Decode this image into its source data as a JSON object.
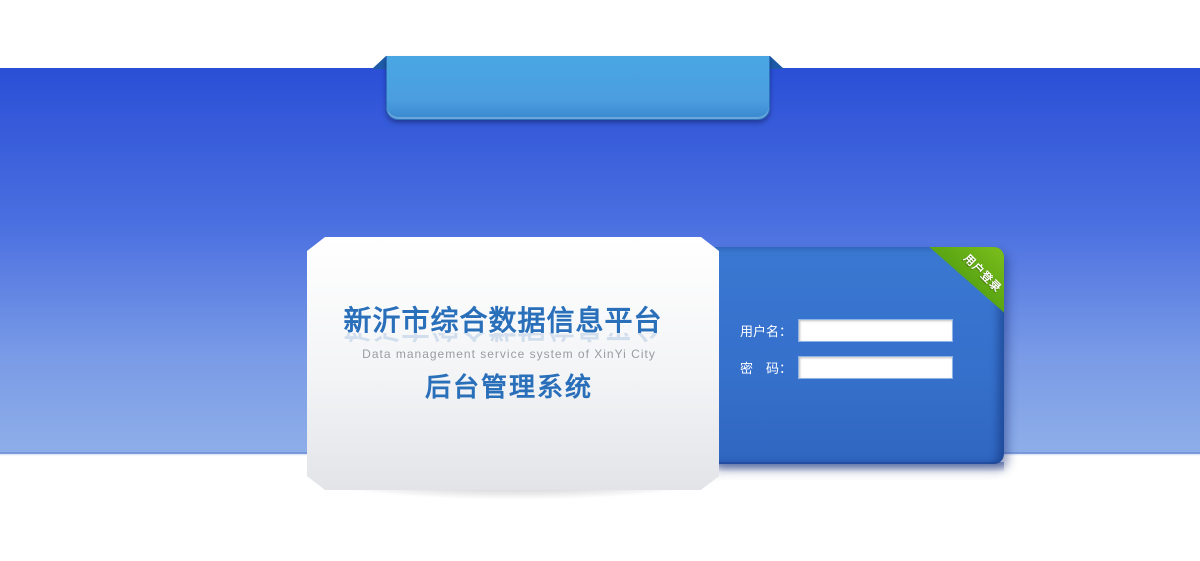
{
  "header": {
    "ribbon_text": ""
  },
  "card": {
    "title": "新沂市综合数据信息平台",
    "subtitle_en": "Data management service system of XinYi City",
    "system_name": "后台管理系统"
  },
  "login": {
    "badge": "用户登录",
    "username_label": "用户名：",
    "username_value": "",
    "password_label": "密　码：",
    "password_value": ""
  },
  "colors": {
    "band_top": "#2a4fd6",
    "band_bottom": "#8eaee9",
    "panel": "#3570cb",
    "badge": "#5aa513",
    "title": "#2a6fba"
  }
}
